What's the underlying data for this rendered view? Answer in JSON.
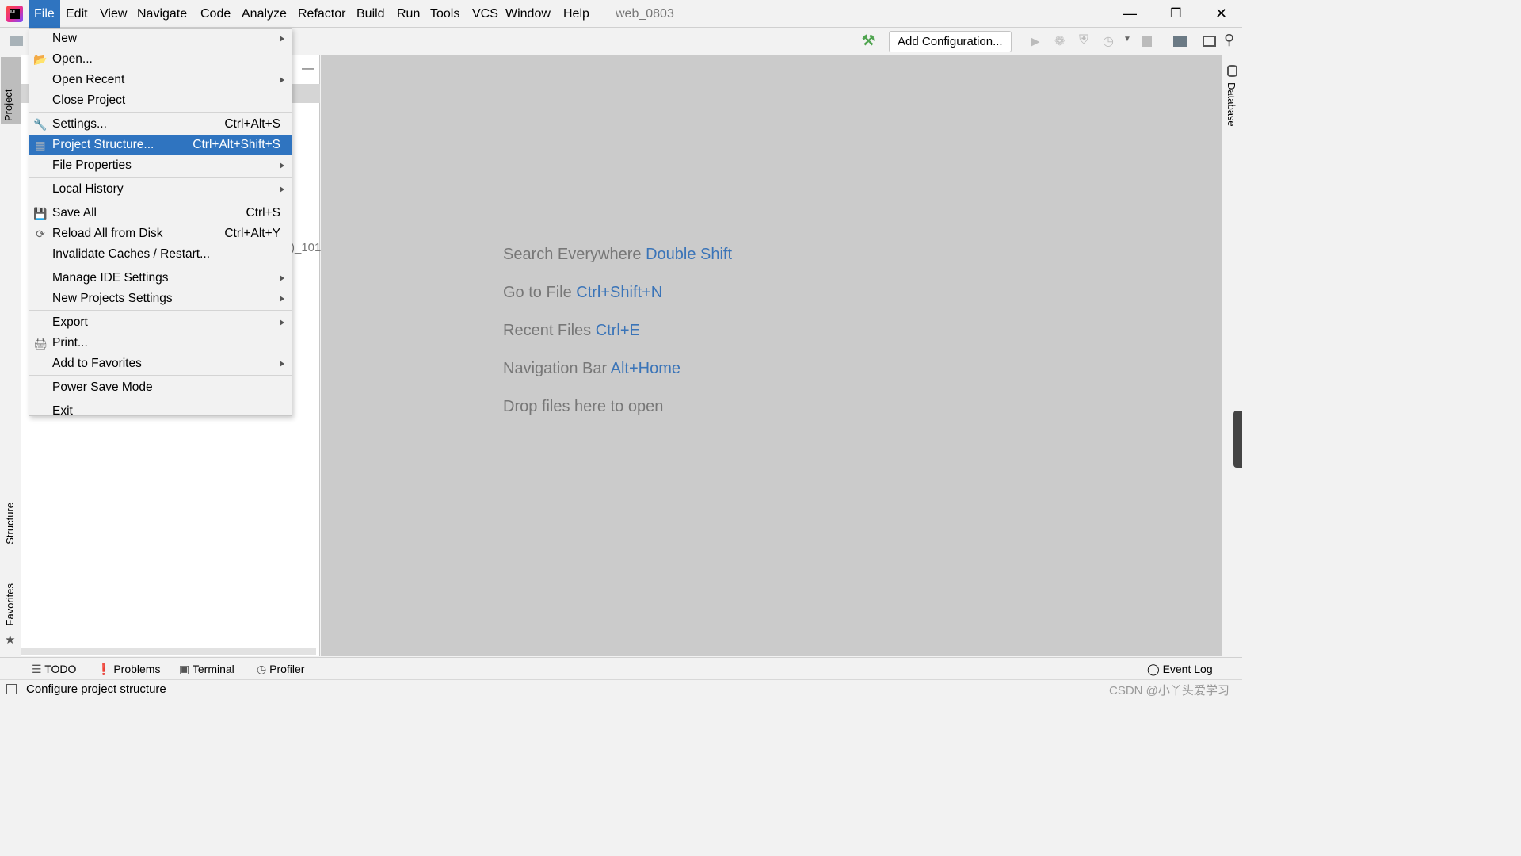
{
  "app": {
    "title": "web_0803",
    "accent": "#2f74c0"
  },
  "menubar": [
    {
      "label": "File",
      "active": true
    },
    {
      "label": "Edit"
    },
    {
      "label": "View"
    },
    {
      "label": "Navigate"
    },
    {
      "label": "Code"
    },
    {
      "label": "Analyze"
    },
    {
      "label": "Refactor"
    },
    {
      "label": "Build"
    },
    {
      "label": "Run"
    },
    {
      "label": "Tools"
    },
    {
      "label": "VCS"
    },
    {
      "label": "Window"
    },
    {
      "label": "Help"
    }
  ],
  "toolbar": {
    "add_configuration": "Add Configuration..."
  },
  "left_tabs": {
    "project": "Project",
    "structure": "Structure",
    "favorites": "Favorites"
  },
  "right_tabs": {
    "database": "Database"
  },
  "project_panel": {
    "partial_text": ")_101"
  },
  "file_menu": {
    "items": [
      {
        "label": "New",
        "submenu": true
      },
      {
        "label": "Open...",
        "icon": "folder-open-icon"
      },
      {
        "label": "Open Recent",
        "submenu": true
      },
      {
        "label": "Close Project"
      },
      {
        "sep": true
      },
      {
        "label": "Settings...",
        "shortcut": "Ctrl+Alt+S",
        "icon": "wrench-icon"
      },
      {
        "label": "Project Structure...",
        "shortcut": "Ctrl+Alt+Shift+S",
        "icon": "project-structure-icon",
        "selected": true
      },
      {
        "label": "File Properties",
        "submenu": true
      },
      {
        "sep": true
      },
      {
        "label": "Local History",
        "submenu": true
      },
      {
        "sep": true
      },
      {
        "label": "Save All",
        "shortcut": "Ctrl+S",
        "icon": "save-icon"
      },
      {
        "label": "Reload All from Disk",
        "shortcut": "Ctrl+Alt+Y",
        "icon": "reload-icon"
      },
      {
        "label": "Invalidate Caches / Restart..."
      },
      {
        "sep": true
      },
      {
        "label": "Manage IDE Settings",
        "submenu": true
      },
      {
        "label": "New Projects Settings",
        "submenu": true
      },
      {
        "sep": true
      },
      {
        "label": "Export",
        "submenu": true
      },
      {
        "label": "Print...",
        "icon": "print-icon"
      },
      {
        "label": "Add to Favorites",
        "submenu": true
      },
      {
        "sep": true
      },
      {
        "label": "Power Save Mode"
      },
      {
        "sep": true
      },
      {
        "label": "Exit"
      }
    ]
  },
  "editor_hints": [
    {
      "text": "Search Everywhere",
      "key": "Double Shift"
    },
    {
      "text": "Go to File",
      "key": "Ctrl+Shift+N"
    },
    {
      "text": "Recent Files",
      "key": "Ctrl+E"
    },
    {
      "text": "Navigation Bar",
      "key": "Alt+Home"
    },
    {
      "text": "Drop files here to open",
      "key": ""
    }
  ],
  "bottom_tabs": [
    {
      "label": "TODO",
      "icon": "list-icon"
    },
    {
      "label": "Problems",
      "icon": "problems-icon"
    },
    {
      "label": "Terminal",
      "icon": "terminal-icon"
    },
    {
      "label": "Profiler",
      "icon": "profiler-icon"
    }
  ],
  "event_log": "Event Log",
  "status": {
    "text": "Configure project structure",
    "watermark": "CSDN @小丫头爱学习"
  }
}
